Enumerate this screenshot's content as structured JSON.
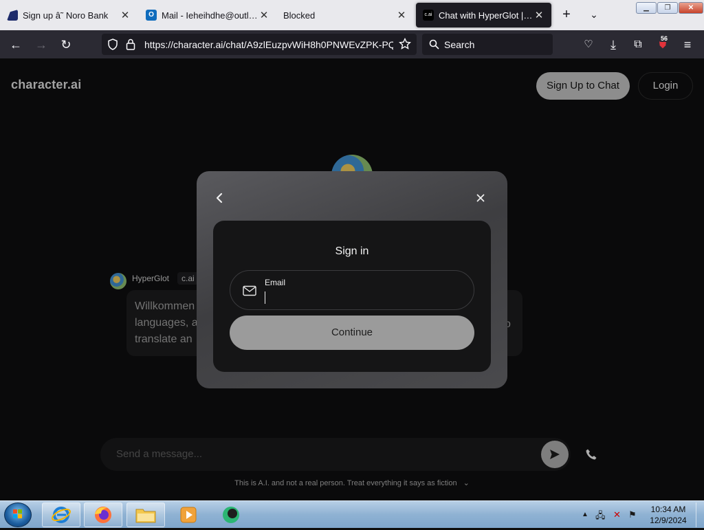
{
  "browser": {
    "tabs": [
      {
        "title": "Sign up â˜ Noro Bank",
        "icon": "noro-bank-icon"
      },
      {
        "title": "Mail - Ieheihdhe@outlook",
        "icon": "outlook-icon"
      },
      {
        "title": "Blocked",
        "icon": ""
      },
      {
        "title": "Chat with HyperGlot | cha",
        "icon": "character-ai-icon",
        "icon_text": "c.ai"
      }
    ],
    "new_tab_label": "+",
    "url": "https://character.ai/chat/A9zlEuzpvWiH8h0PNWEvZPK-PQ",
    "search_placeholder": "Search",
    "extension_badge": "56"
  },
  "page": {
    "logo": "character.ai",
    "signup_button": "Sign Up to Chat",
    "login_button": "Login",
    "message": {
      "author": "HyperGlot",
      "tag": "c.ai",
      "lines": [
        "Willkommen",
        "languages, a",
        "translate an"
      ],
      "tail": "o"
    },
    "composer_placeholder": "Send a message...",
    "disclaimer": "This is A.I. and not a real person. Treat everything it says as fiction"
  },
  "modal": {
    "title": "Sign in",
    "email_label": "Email",
    "email_value": "",
    "continue_button": "Continue"
  },
  "taskbar": {
    "time": "10:34 AM",
    "date": "12/9/2024"
  },
  "colors": {
    "page_bg": "#0e0e0f",
    "modal_bg": "#4a4a4d",
    "continue_bg": "#9b9b9b",
    "tabbar_bg": "#e9e9ed",
    "navbar_bg": "#2b2a33"
  }
}
